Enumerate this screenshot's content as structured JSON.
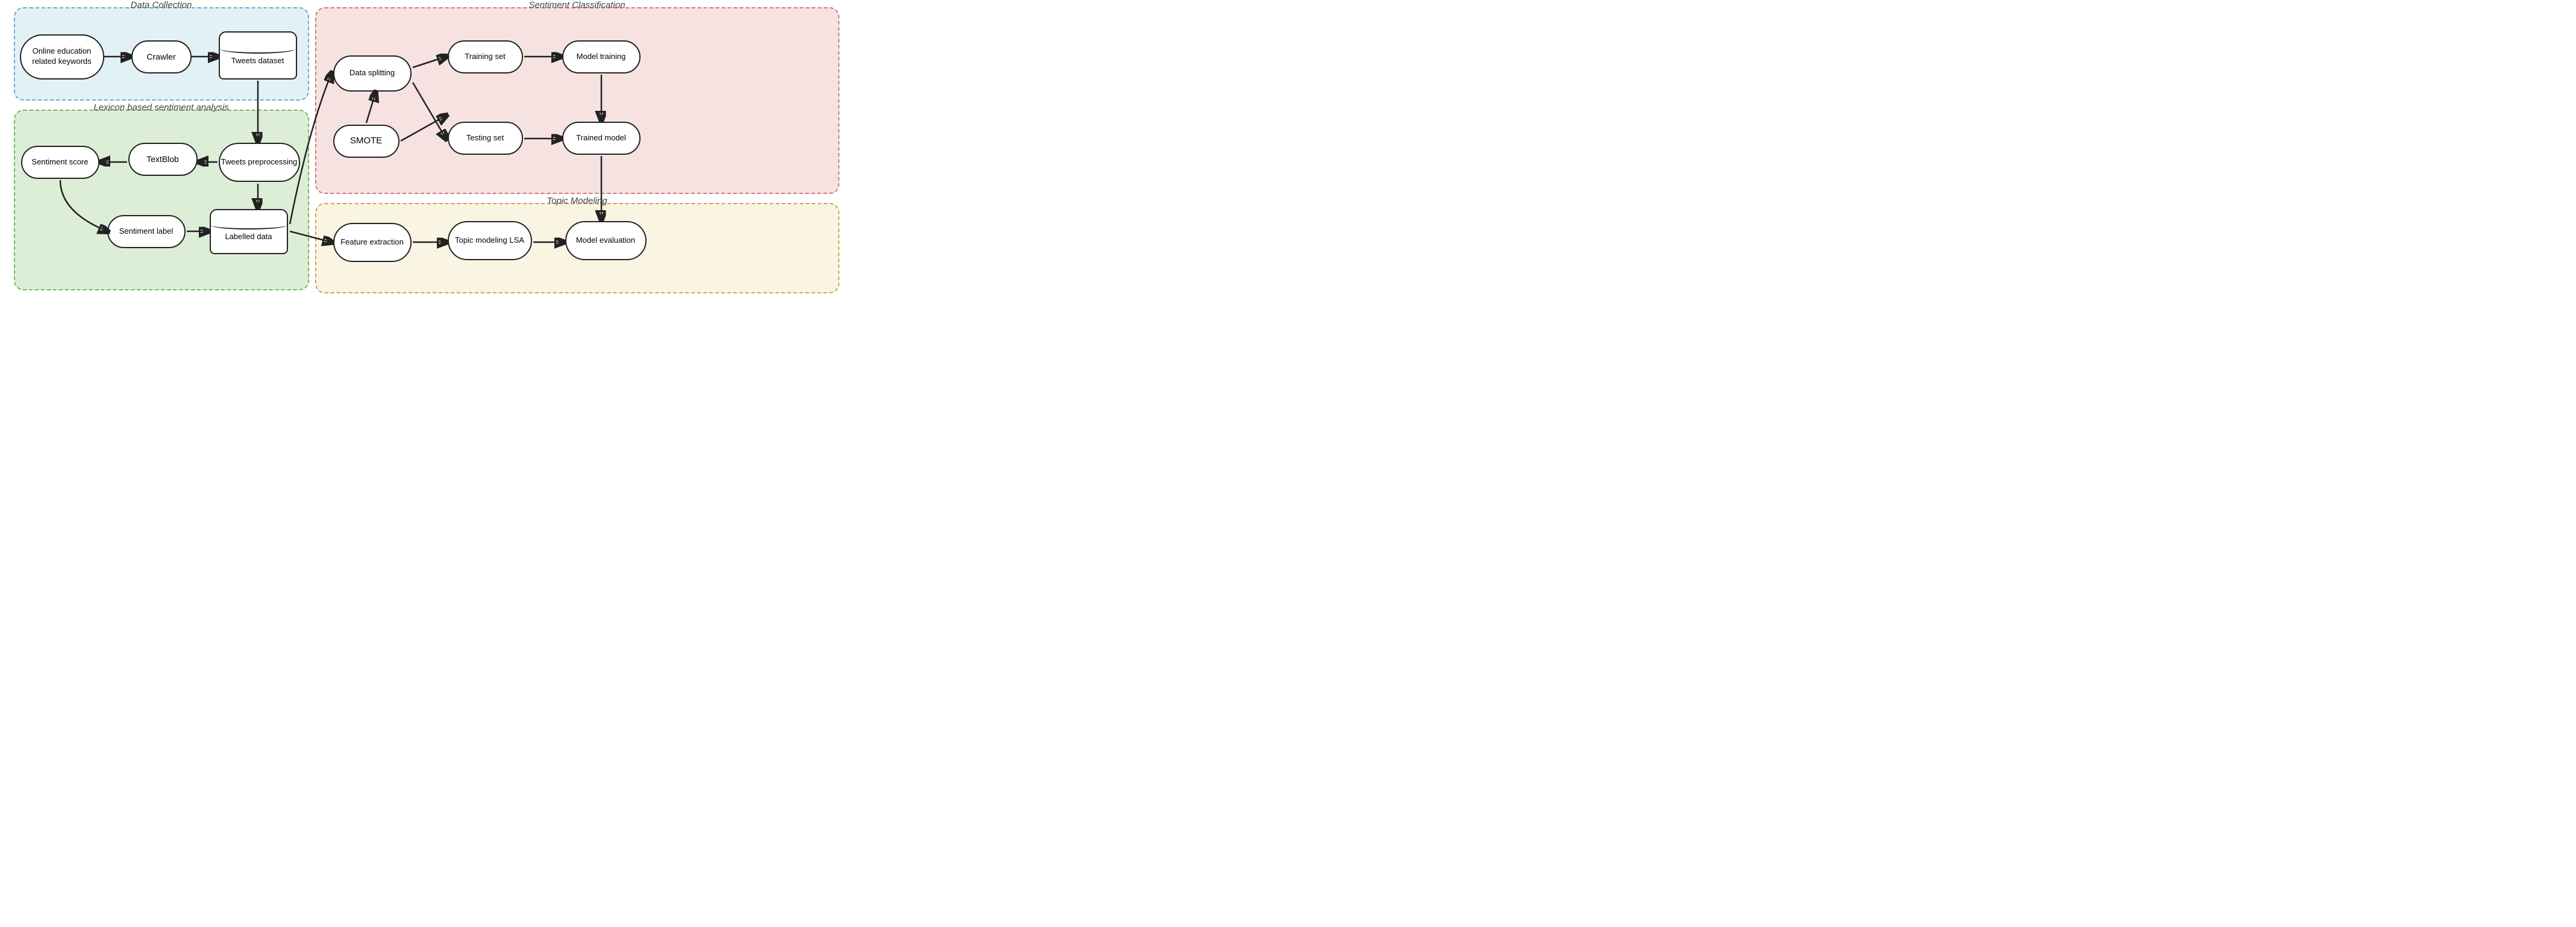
{
  "sections": {
    "data_collection": {
      "label": "Data Collection"
    },
    "lexicon": {
      "label": "Lexicon based sentiment analysis"
    },
    "sentiment": {
      "label": "Sentiment Classification"
    },
    "topic": {
      "label": "Topic Modeling"
    }
  },
  "nodes": {
    "online_keywords": {
      "text": "Online education\nrelated keywords"
    },
    "crawler": {
      "text": "Crawler"
    },
    "tweets_dataset": {
      "text": "Tweets dataset"
    },
    "tweets_preprocessing": {
      "text": "Tweets\npreprocessing"
    },
    "textblob": {
      "text": "TextBlob"
    },
    "sentiment_score": {
      "text": "Sentiment score"
    },
    "sentiment_label": {
      "text": "Sentiment label"
    },
    "labelled_data": {
      "text": "Labelled data"
    },
    "data_splitting": {
      "text": "Data splitting"
    },
    "training_set": {
      "text": "Training set"
    },
    "model_training": {
      "text": "Model training"
    },
    "smote": {
      "text": "SMOTE"
    },
    "testing_set": {
      "text": "Testing set"
    },
    "trained_model": {
      "text": "Trained model"
    },
    "feature_extraction": {
      "text": "Feature\nextraction"
    },
    "topic_modeling_lsa": {
      "text": "Topic modeling\nLSA"
    },
    "model_evaluation": {
      "text": "Model evaluation"
    }
  }
}
